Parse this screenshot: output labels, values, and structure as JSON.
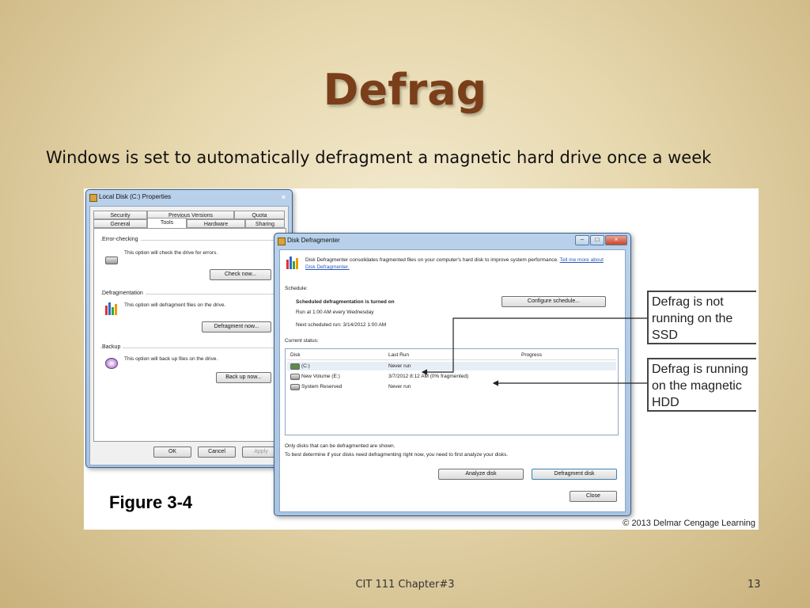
{
  "slide": {
    "title": "Defrag",
    "subtitle": "Windows is set to automatically defragment  a magnetic hard drive once a week",
    "footer": "CIT 111 Chapter#3",
    "page_number": "13"
  },
  "figure": {
    "label": "Figure 3-4",
    "credit": "© 2013 Delmar Cengage Learning",
    "callout_ssd": "Defrag is not running on the SSD",
    "callout_hdd": "Defrag is running on the magnetic HDD"
  },
  "properties_dialog": {
    "title": "Local Disk (C:) Properties",
    "close_glyph": "×",
    "tabs_row1": [
      "Security",
      "Previous Versions",
      "Quota"
    ],
    "tabs_row2": [
      "General",
      "Tools",
      "Hardware",
      "Sharing"
    ],
    "active_tab": "Tools",
    "error_checking": {
      "heading": "Error-checking",
      "text": "This option will check the drive for errors.",
      "button": "Check now..."
    },
    "defragmentation": {
      "heading": "Defragmentation",
      "text": "This option will defragment files on the drive.",
      "button": "Defragment now..."
    },
    "backup": {
      "heading": "Backup",
      "text": "This option will back up files on the drive.",
      "button": "Back up now..."
    },
    "buttons": {
      "ok": "OK",
      "cancel": "Cancel",
      "apply": "Apply"
    }
  },
  "defrag_dialog": {
    "title": "Disk Defragmenter",
    "window_controls": {
      "minimize": "–",
      "maximize": "□",
      "close": "×"
    },
    "intro": "Disk Defragmenter consolidates fragmented files on your computer's hard disk to improve system performance.",
    "intro_link": "Tell me more about Disk Defragmenter.",
    "schedule_heading": "Schedule:",
    "schedule_status": "Scheduled defragmentation is turned on",
    "schedule_run": "Run at 1:00 AM every Wednesday",
    "schedule_next": "Next scheduled run: 3/14/2012 1:00 AM",
    "configure_button": "Configure schedule...",
    "current_status_heading": "Current status:",
    "columns": [
      "Disk",
      "Last Run",
      "Progress"
    ],
    "rows": [
      {
        "disk": "(C:)",
        "last_run": "Never run"
      },
      {
        "disk": "New Volume (E:)",
        "last_run": "3/7/2012 8:12 AM (0% fragmented)"
      },
      {
        "disk": "System Reserved",
        "last_run": "Never run"
      }
    ],
    "note1": "Only disks that can be defragmented are shown.",
    "note2": "To best determine if your disks need defragmenting right now, you need to first analyze your disks.",
    "analyze_button": "Analyze disk",
    "defragment_button": "Defragment disk",
    "close_button": "Close"
  }
}
